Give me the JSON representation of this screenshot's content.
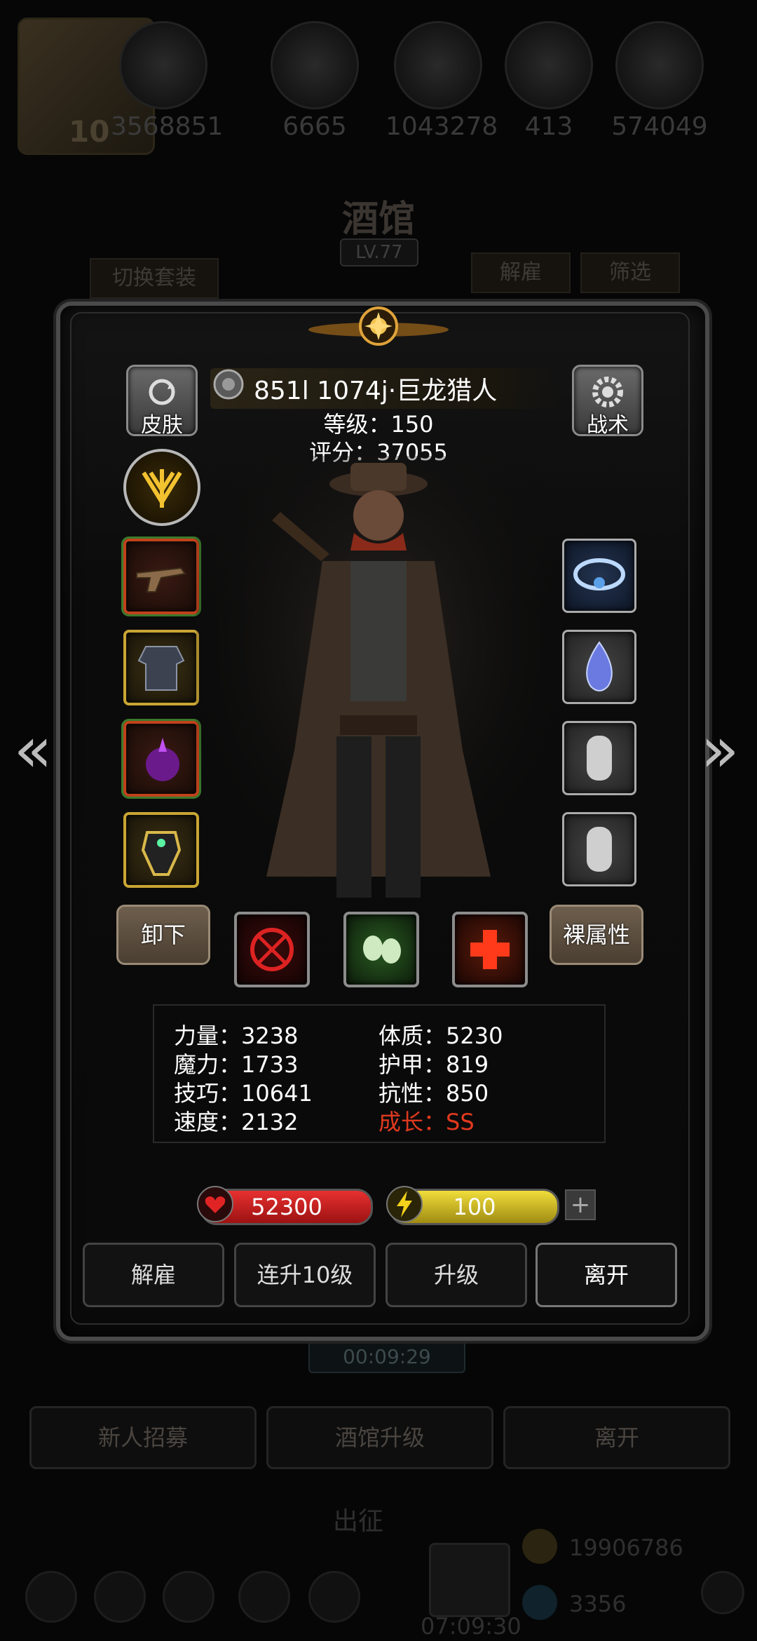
{
  "top_bar": {
    "avatar_level": "10",
    "resources": [
      {
        "icon": "coin-stack-icon",
        "value": "3568851"
      },
      {
        "icon": "bread-icon",
        "value": "6665"
      },
      {
        "icon": "ore-icon",
        "value": "1043278"
      },
      {
        "icon": "crystal-icon",
        "value": "413"
      },
      {
        "icon": "wood-icon",
        "value": "574049"
      }
    ]
  },
  "tavern": {
    "title": "酒馆",
    "level": "LV.77",
    "switch_set_label": "切换套装",
    "dismiss_label": "解雇",
    "filter_label": "筛选",
    "timer": "00:09:29",
    "new_recruit_label": "新人招募",
    "upgrade_label": "酒馆升级",
    "leave_label": "离开"
  },
  "expedition": {
    "label": "出征",
    "gold": "19906786",
    "gems": "3356",
    "timer": "07:09:30"
  },
  "hero": {
    "name": "851l 1074j·巨龙猎人",
    "level_line": "等级：150",
    "score_line": "评分：37055",
    "skin_label": "皮肤",
    "tactics_label": "战术",
    "unequip_label": "卸下",
    "naked_stats_label": "裸属性",
    "stats": {
      "strength": "力量：3238",
      "constitution": "体质：5230",
      "magic": "魔力：1733",
      "armor": "护甲：819",
      "skill": "技巧：10641",
      "resistance": "抗性：850",
      "speed": "速度：2132",
      "growth": "成长：SS"
    },
    "hp": "52300",
    "energy": "100",
    "energy_plus": "+",
    "growth_color": "#e0391f",
    "hp_color": "#d11d1d",
    "energy_color": "#d9c51d"
  },
  "actions": {
    "dismiss": "解雇",
    "level_up_10": "连升10级",
    "level_up": "升级",
    "leave": "离开"
  },
  "nav": {
    "prev_arrow": "«",
    "next_arrow": "»"
  }
}
